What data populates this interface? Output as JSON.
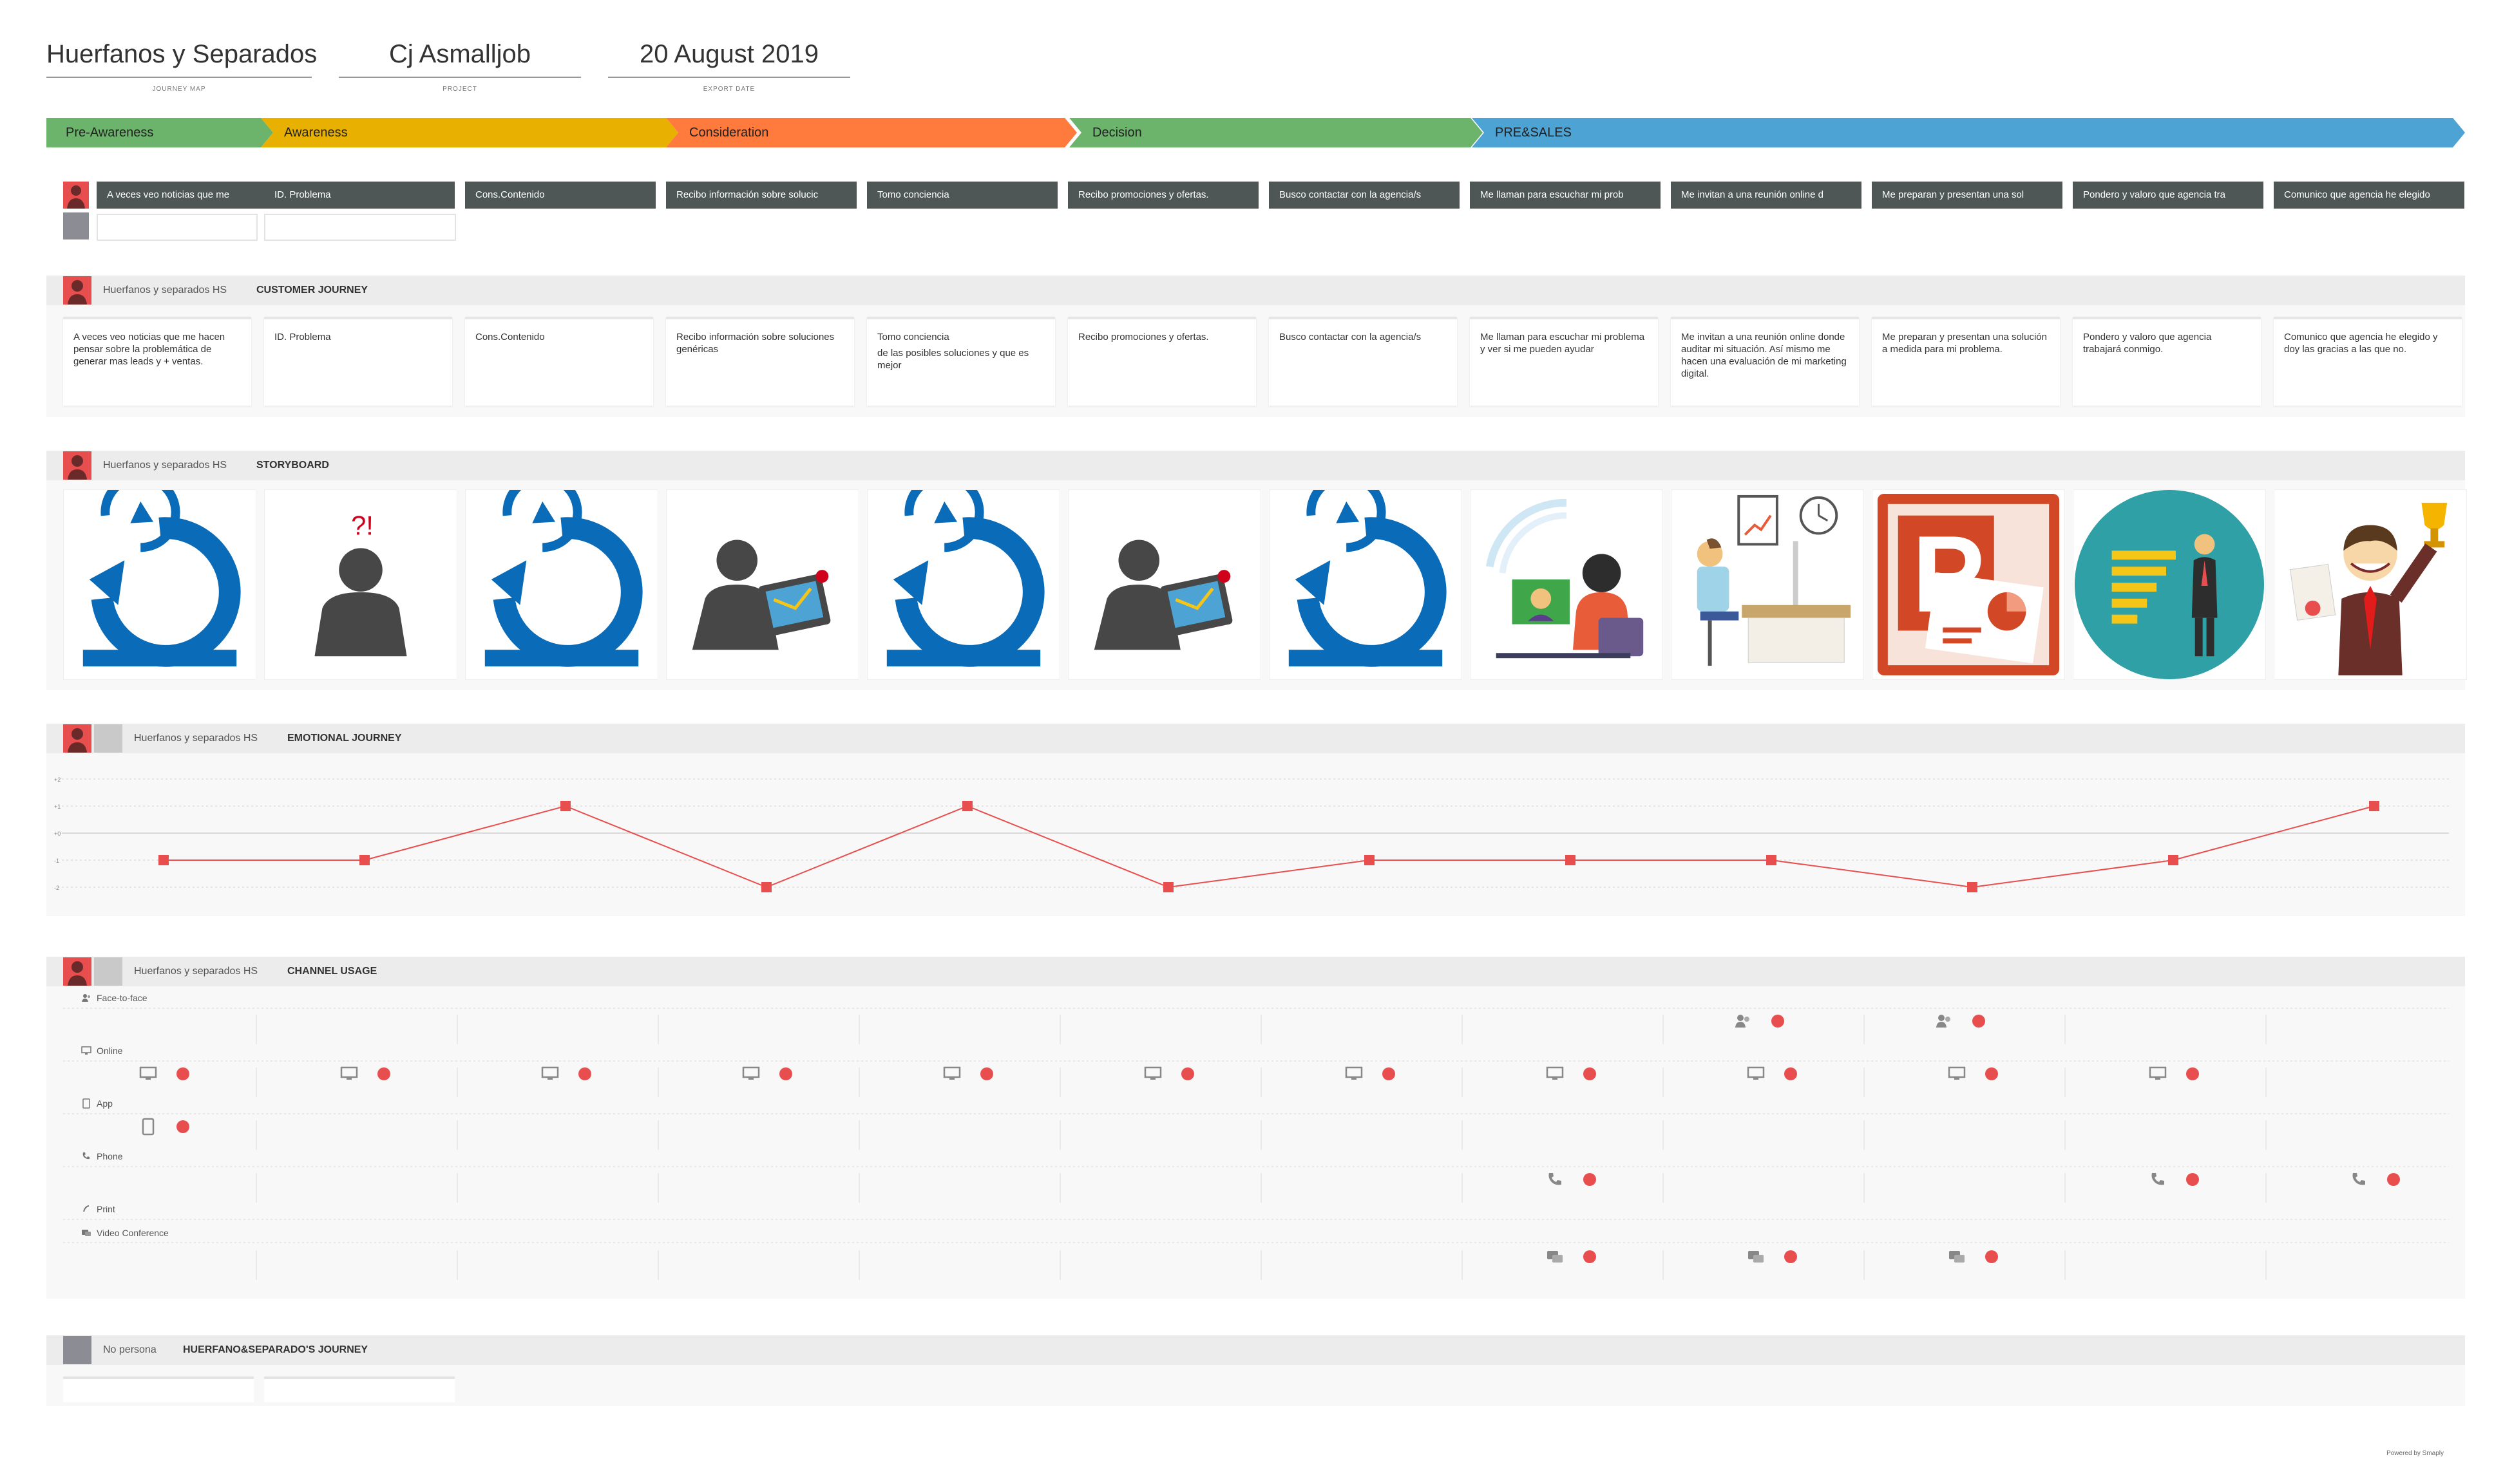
{
  "header": {
    "journey_map": {
      "value": "Huerfanos y Separados",
      "label": "JOURNEY MAP"
    },
    "project": {
      "value": "Cj Asmalljob",
      "label": "PROJECT"
    },
    "export_date": {
      "value": "20 August 2019",
      "label": "EXPORT DATE"
    }
  },
  "stages": [
    {
      "name": "Pre-Awareness",
      "color": "#6cb36c"
    },
    {
      "name": "Awareness",
      "color": "#e8b000"
    },
    {
      "name": "Consideration",
      "color": "#ff7a3d"
    },
    {
      "name": "Decision",
      "color": "#6cb36c"
    },
    {
      "name": "PRE&SALES",
      "color": "#4da3d3"
    }
  ],
  "steps": [
    "A veces veo noticias que me",
    "ID. Problema",
    "Cons.Contenido",
    "Recibo información sobre solucic",
    "Tomo conciencia",
    "Recibo promociones y ofertas.",
    "Busco contactar con la agencia/s",
    "Me llaman para escuchar mi prob",
    "Me invitan a una reunión online d",
    "Me preparan y presentan una sol",
    "Pondero y valoro que agencia tra",
    "Comunico que agencia he elegido"
  ],
  "customer_journey": {
    "persona": "Huerfanos y separados HS",
    "title": "CUSTOMER JOURNEY",
    "cards": [
      {
        "text": "A veces veo noticias que me hacen pensar sobre la problemática de generar mas leads y + ventas.",
        "extra": ""
      },
      {
        "text": "ID. Problema",
        "extra": ""
      },
      {
        "text": "Cons.Contenido",
        "extra": ""
      },
      {
        "text": "Recibo información sobre soluciones genéricas",
        "extra": ""
      },
      {
        "text": "Tomo conciencia",
        "extra": "de las posibles soluciones y que es mejor"
      },
      {
        "text": "Recibo promociones y ofertas.",
        "extra": ""
      },
      {
        "text": "Busco contactar con la agencia/s",
        "extra": ""
      },
      {
        "text": "Me llaman para escuchar mi problema y ver si me pueden ayudar",
        "extra": ""
      },
      {
        "text": "Me invitan a una reunión online donde auditar mi situación. Así mismo me hacen una evaluación de mi marketing digital.",
        "extra": ""
      },
      {
        "text": "Me preparan y presentan una solución a medida para mi problema.",
        "extra": ""
      },
      {
        "text": "Pondero y valoro que agencia trabajará conmigo.",
        "extra": ""
      },
      {
        "text": "Comunico que agencia he elegido y doy las gracias a las que no.",
        "extra": ""
      }
    ]
  },
  "storyboard": {
    "persona": "Huerfanos y separados HS",
    "title": "STORYBOARD",
    "images": [
      "cycle-icon",
      "question-person-icon",
      "cycle-icon",
      "person-laptop-icon",
      "cycle-icon",
      "person-laptop-icon",
      "cycle-icon",
      "video-call-illustration",
      "office-worker-illustration",
      "powerpoint-logo",
      "rating-badge-illustration",
      "trophy-businessman-illustration"
    ]
  },
  "emotional_journey": {
    "persona": "Huerfanos y separados HS",
    "title": "EMOTIONAL JOURNEY",
    "y_labels": [
      "+2",
      "+1",
      "+0",
      "-1",
      "-2"
    ],
    "line_color": "#e94e4e"
  },
  "chart_data": {
    "type": "line",
    "x": [
      1,
      2,
      3,
      4,
      5,
      6,
      7,
      8,
      9,
      10,
      11,
      12
    ],
    "values": [
      -1,
      -1,
      1,
      -2,
      1,
      -2,
      -1,
      -1,
      -1,
      -2,
      -1,
      1
    ],
    "ylim": [
      -2,
      2
    ],
    "yticks": [
      "+2",
      "+1",
      "+0",
      "-1",
      "-2"
    ],
    "grid": true,
    "title": "",
    "xlabel": "",
    "ylabel": ""
  },
  "channel_usage": {
    "persona": "Huerfanos y separados HS",
    "title": "CHANNEL USAGE",
    "channels": [
      {
        "name": "Face-to-face",
        "icon": "people-icon",
        "steps": [
          9,
          10
        ]
      },
      {
        "name": "Online",
        "icon": "monitor-icon",
        "steps": [
          1,
          2,
          3,
          4,
          5,
          6,
          7,
          8,
          9,
          10,
          11
        ]
      },
      {
        "name": "App",
        "icon": "tablet-icon",
        "steps": [
          1
        ]
      },
      {
        "name": "Phone",
        "icon": "phone-icon",
        "steps": [
          8,
          11,
          12
        ]
      },
      {
        "name": "Print",
        "icon": "print-icon",
        "steps": []
      },
      {
        "name": "Video Conference",
        "icon": "video-chat-icon",
        "steps": [
          8,
          9,
          10
        ]
      }
    ]
  },
  "persona_journey": {
    "persona": "No persona",
    "title": "HUERFANO&SEPARADO'S JOURNEY"
  },
  "footer": "Powered by Smaply"
}
